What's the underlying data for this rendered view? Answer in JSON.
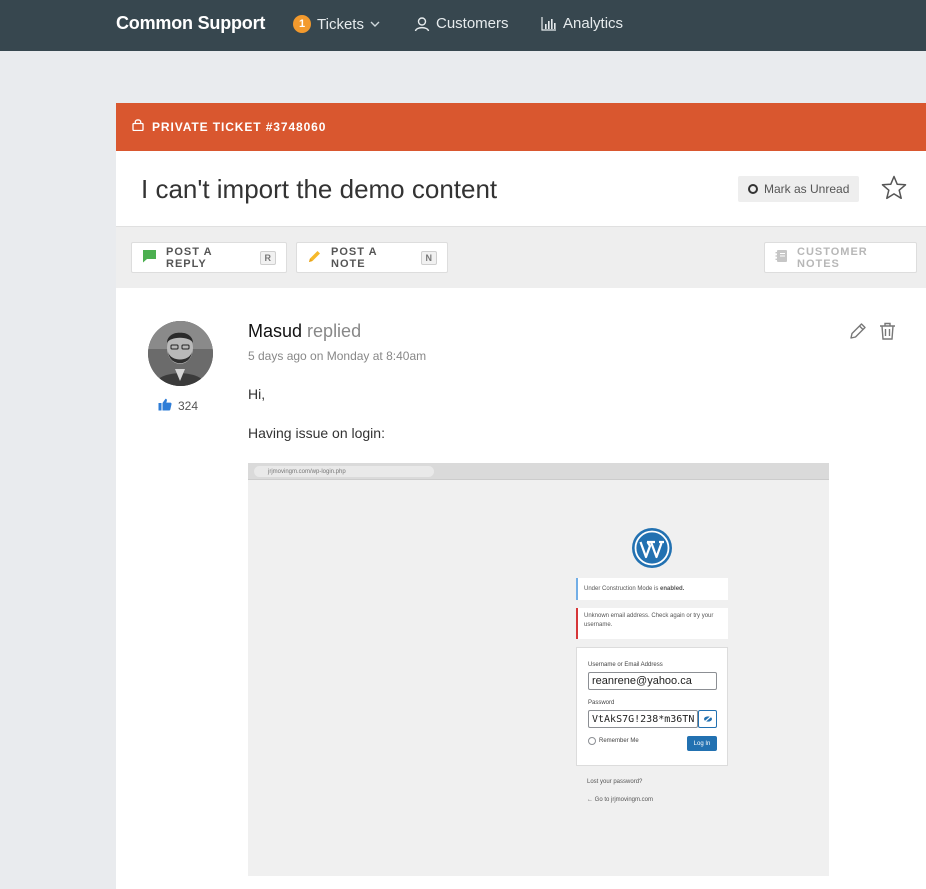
{
  "nav": {
    "brand": "Common Support",
    "tickets_badge": "1",
    "tickets_label": "Tickets",
    "customers_label": "Customers",
    "analytics_label": "Analytics"
  },
  "ticket": {
    "bar_label": "PRIVATE TICKET #3748060",
    "title": "I can't import the demo content",
    "mark_unread_label": "Mark as Unread"
  },
  "actions": {
    "reply_label": "POST A REPLY",
    "reply_key": "R",
    "note_label": "POST A NOTE",
    "note_key": "N",
    "customer_notes_label": "CUSTOMER NOTES"
  },
  "reply": {
    "author": "Masud",
    "verb": "replied",
    "timestamp": "5 days ago on Monday at 8:40am",
    "likes": "324",
    "body": [
      "Hi,",
      "Having issue on login:"
    ]
  },
  "attachment": {
    "url": "jrjmovingm.com/wp-login.php",
    "notice_1_text": "Under Construction Mode is ",
    "notice_1_bold": "enabled.",
    "notice_2_text": "Unknown email address. Check again or try your username.",
    "username_label": "Username or Email Address",
    "username_value": "reanrene@yahoo.ca",
    "password_label": "Password",
    "password_value": "VtAkS7G!238*m36TN",
    "remember_label": "Remember Me",
    "login_label": "Log In",
    "lost_password": "Lost your password?",
    "back_link": "← Go to jrjmovingm.com"
  },
  "colors": {
    "nav_bg": "#37474f",
    "ticket_bar": "#d9572f",
    "badge": "#f39a2d",
    "wp_blue": "#2271b1"
  }
}
